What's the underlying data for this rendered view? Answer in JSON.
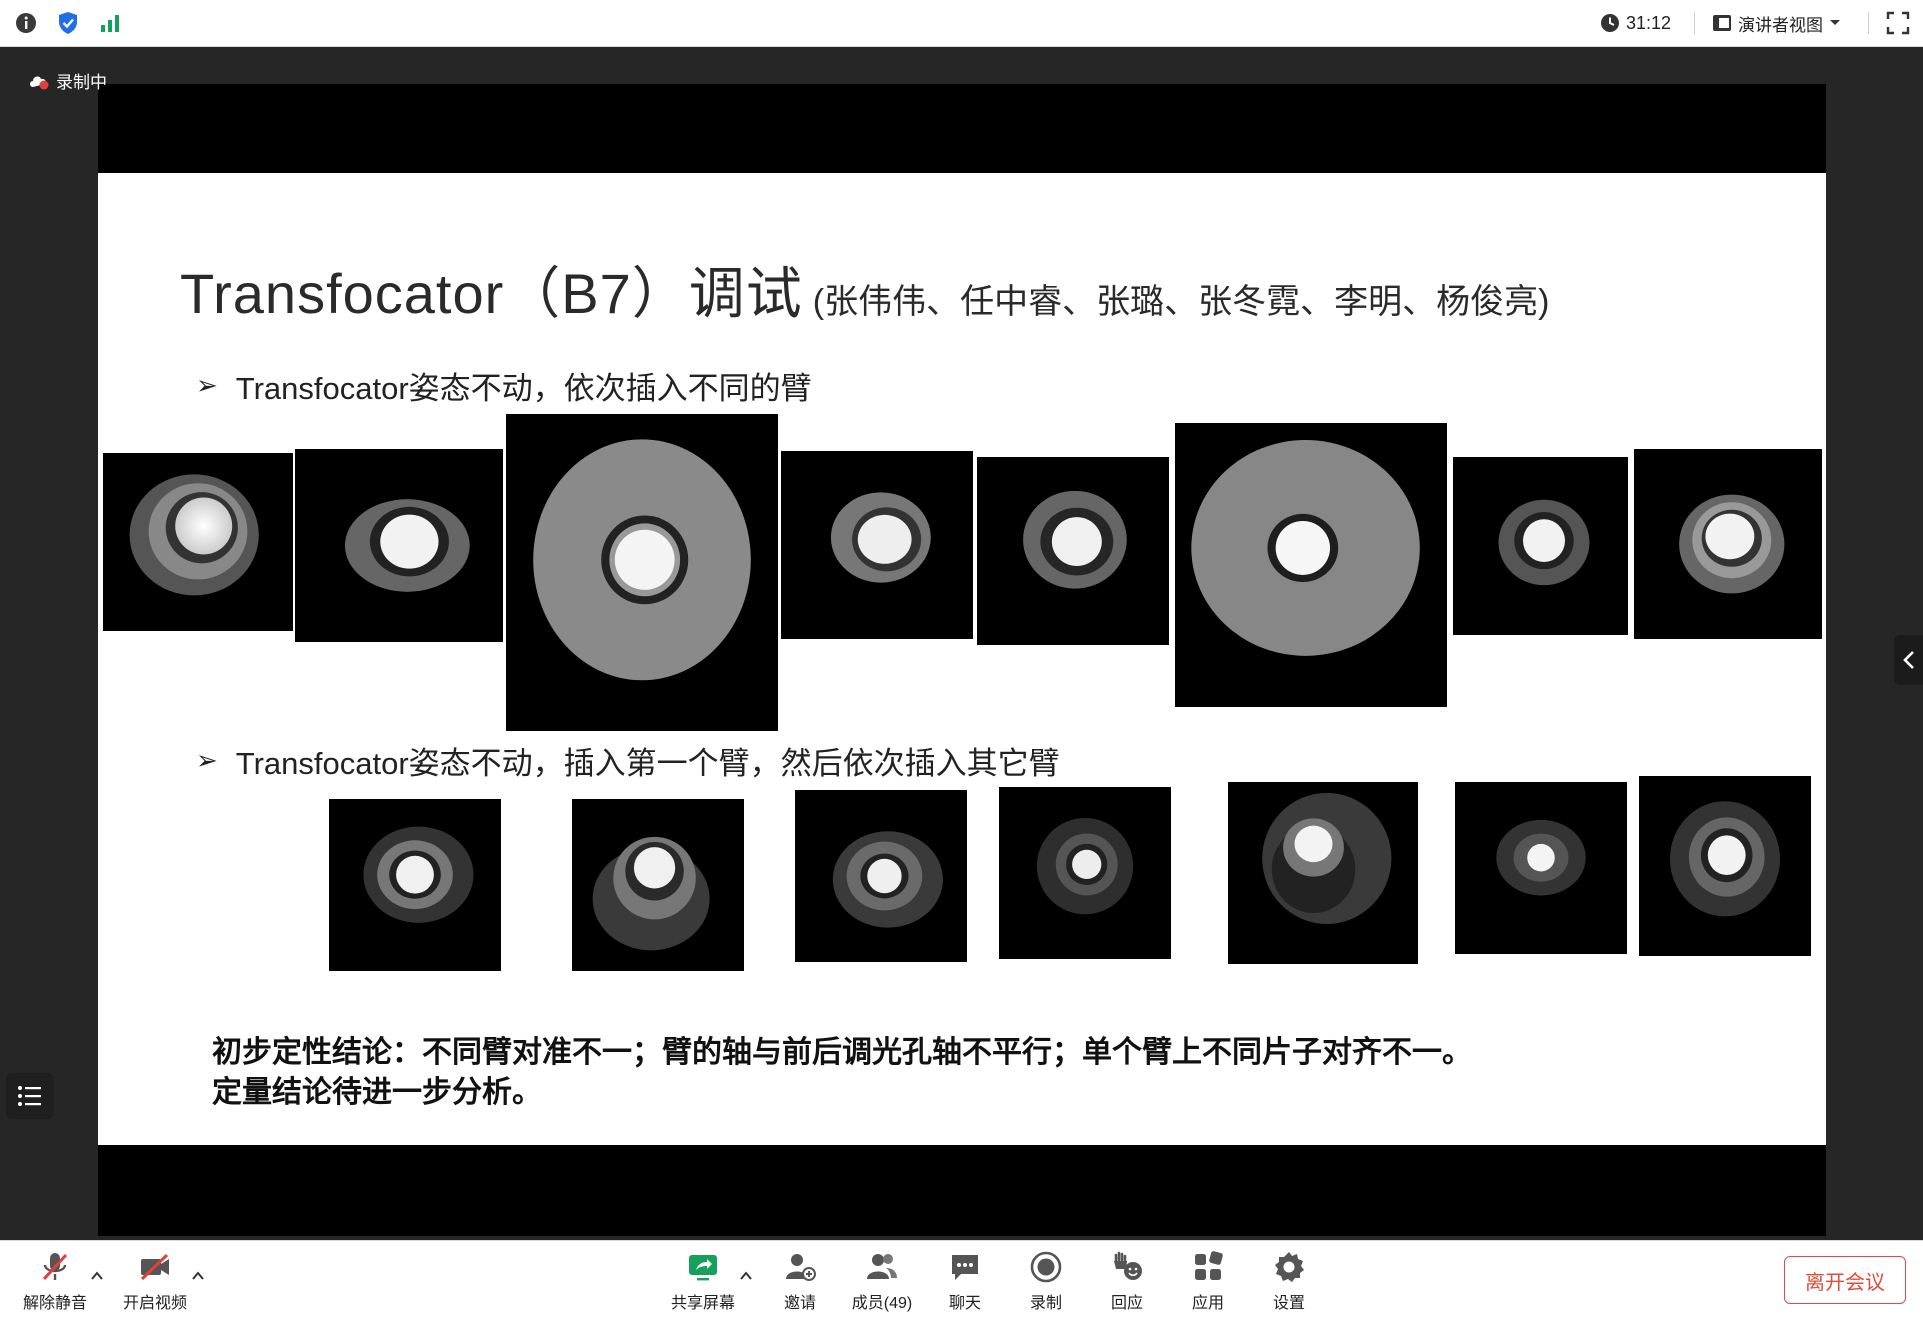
{
  "topbar": {
    "timer": "31:12",
    "view_label": "演讲者视图"
  },
  "recording": {
    "label": "录制中"
  },
  "slide": {
    "title_main": "Transfocator（B7）调试",
    "title_names": "(张伟伟、任中睿、张璐、张冬霓、李明、杨俊亮)",
    "bullet1": "Transfocator姿态不动，依次插入不同的臂",
    "bullet2": "Transfocator姿态不动，插入第一个臂，然后依次插入其它臂",
    "conclusion_line1": "初步定性结论：不同臂对准不一；臂的轴与前后调光孔轴不平行；单个臂上不同片子对齐不一。",
    "conclusion_line2": "定量结论待进一步分析。"
  },
  "toolbar": {
    "unmute": "解除静音",
    "start_video": "开启视频",
    "share_screen": "共享屏幕",
    "invite": "邀请",
    "members": "成员(49)",
    "chat": "聊天",
    "record": "录制",
    "reactions": "回应",
    "apps": "应用",
    "settings": "设置",
    "leave": "离开会议"
  },
  "colors": {
    "accent_blue": "#1e6fe8",
    "share_green": "#16a05d",
    "leave_red": "#e04b3c",
    "muted_red": "#e2403a"
  }
}
